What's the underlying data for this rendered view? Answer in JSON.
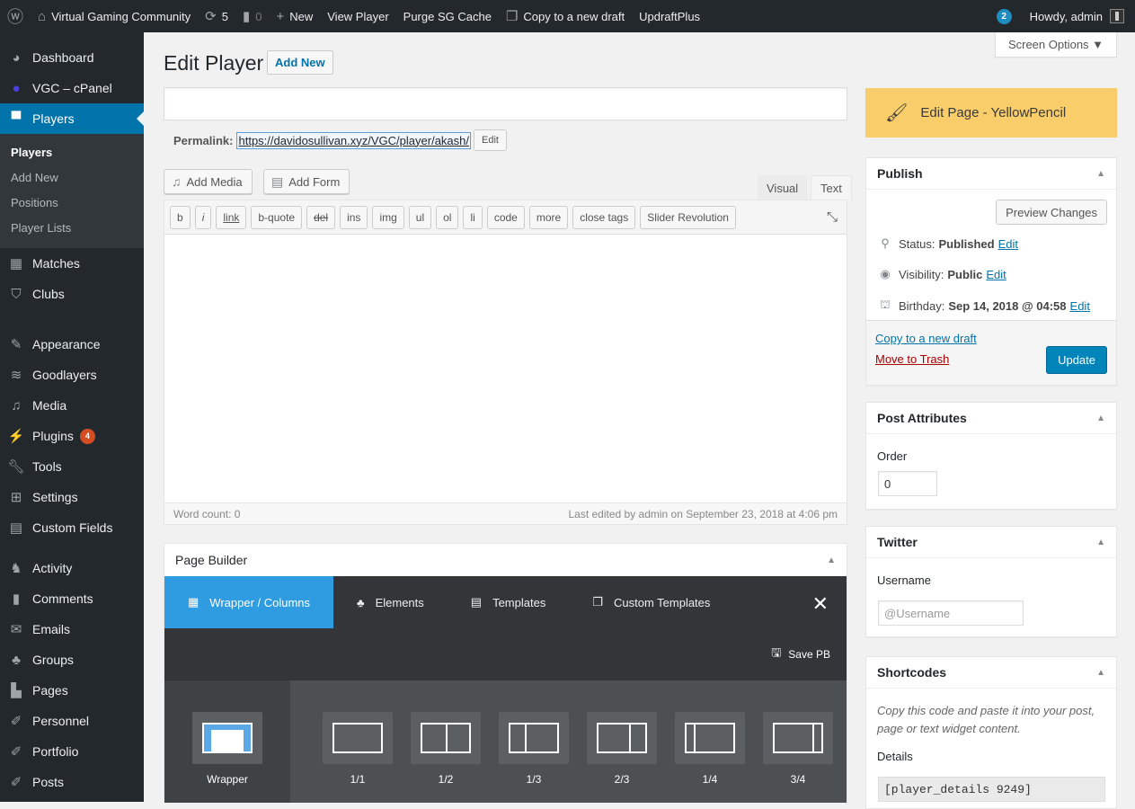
{
  "adminbar": {
    "site_name": "Virtual Gaming Community",
    "updates_count": "5",
    "comments_count": "0",
    "new_label": "New",
    "view_label": "View Player",
    "purge_label": "Purge SG Cache",
    "copy_label": "Copy to a new draft",
    "updraft_label": "UpdraftPlus",
    "notif_count": "2",
    "howdy": "Howdy, admin"
  },
  "screen_options": "Screen Options ▼",
  "sidebar": {
    "items": [
      {
        "label": "Dashboard",
        "icon": "dashboard-icon"
      },
      {
        "label": "VGC – cPanel",
        "icon": "cpanel-icon"
      },
      {
        "label": "Players",
        "icon": "shirt-icon"
      },
      {
        "label": "Matches",
        "icon": "calendar-icon"
      },
      {
        "label": "Clubs",
        "icon": "shield-icon"
      },
      {
        "label": "Appearance",
        "icon": "paintbrush-icon"
      },
      {
        "label": "Goodlayers",
        "icon": "layers-icon"
      },
      {
        "label": "Media",
        "icon": "media-icon"
      },
      {
        "label": "Plugins",
        "icon": "plugin-icon",
        "badge": "4"
      },
      {
        "label": "Tools",
        "icon": "wrench-icon"
      },
      {
        "label": "Settings",
        "icon": "settings-icon"
      },
      {
        "label": "Custom Fields",
        "icon": "fields-icon"
      },
      {
        "label": "Activity",
        "icon": "activity-icon"
      },
      {
        "label": "Comments",
        "icon": "comment-icon"
      },
      {
        "label": "Emails",
        "icon": "envelope-icon"
      },
      {
        "label": "Groups",
        "icon": "groups-icon"
      },
      {
        "label": "Pages",
        "icon": "pages-icon"
      },
      {
        "label": "Personnel",
        "icon": "pin-icon"
      },
      {
        "label": "Portfolio",
        "icon": "pin-icon"
      },
      {
        "label": "Posts",
        "icon": "pin-icon"
      }
    ],
    "submenu": [
      "Players",
      "Add New",
      "Positions",
      "Player Lists"
    ]
  },
  "page": {
    "title": "Edit Player",
    "add_new": "Add New",
    "title_value": "",
    "permalink_label": "Permalink:",
    "permalink_url": "https://davidosullivan.xyz/VGC/player/akash/",
    "permalink_edit": "Edit"
  },
  "editor": {
    "add_media": "Add Media",
    "add_form": "Add Form",
    "tab_visual": "Visual",
    "tab_text": "Text",
    "quicktags": [
      "b",
      "i",
      "link",
      "b-quote",
      "del",
      "ins",
      "img",
      "ul",
      "ol",
      "li",
      "code",
      "more",
      "close tags",
      "Slider Revolution"
    ],
    "content": "",
    "word_count": "Word count: 0",
    "last_edited": "Last edited by admin on September 23, 2018 at 4:06 pm"
  },
  "page_builder": {
    "title": "Page Builder",
    "tabs": [
      "Wrapper / Columns",
      "Elements",
      "Templates",
      "Custom Templates"
    ],
    "save": "Save PB",
    "wrapper": "Wrapper",
    "columns": [
      "1/1",
      "1/2",
      "1/3",
      "2/3",
      "1/4",
      "3/4"
    ]
  },
  "yellowpencil": "Edit Page - YellowPencil",
  "publish": {
    "title": "Publish",
    "preview": "Preview Changes",
    "status_label": "Status:",
    "status_value": "Published",
    "visibility_label": "Visibility:",
    "visibility_value": "Public",
    "birthday_label": "Birthday:",
    "birthday_value": "Sep 14, 2018 @ 04:58",
    "edit": "Edit",
    "copy_draft": "Copy to a new draft",
    "trash": "Move to Trash",
    "update": "Update"
  },
  "attributes": {
    "title": "Post Attributes",
    "order_label": "Order",
    "order_value": "0"
  },
  "twitter": {
    "title": "Twitter",
    "username_label": "Username",
    "username_placeholder": "@Username"
  },
  "shortcodes": {
    "title": "Shortcodes",
    "help": "Copy this code and paste it into your post, page or text widget content.",
    "details_label": "Details",
    "details_code": "[player_details 9249]"
  },
  "colors": {
    "adminbar_bg": "#23282d",
    "active_menu": "#0073aa",
    "update_button": "#0085ba",
    "yellowpencil_bg": "#f9cd6a",
    "pb_active_tab": "#2f9be0",
    "plugin_badge": "#d54e21"
  }
}
